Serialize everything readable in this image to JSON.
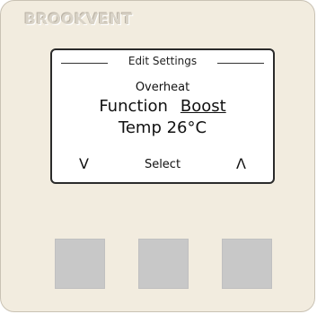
{
  "brand": "BROOKVENT",
  "screen": {
    "header_title": "Edit Settings",
    "mode": "Overheat",
    "function_label": "Function",
    "function_value": "Boost",
    "temperature": "Temp 26°C",
    "nav": {
      "down": "V",
      "select": "Select",
      "up": "Λ"
    }
  },
  "buttons": [
    "down",
    "select",
    "up"
  ],
  "colors": {
    "panel": "#f2ecdf",
    "screen_bg": "#ffffff",
    "screen_border": "#2b2b2b",
    "button": "#c8c8c8"
  }
}
